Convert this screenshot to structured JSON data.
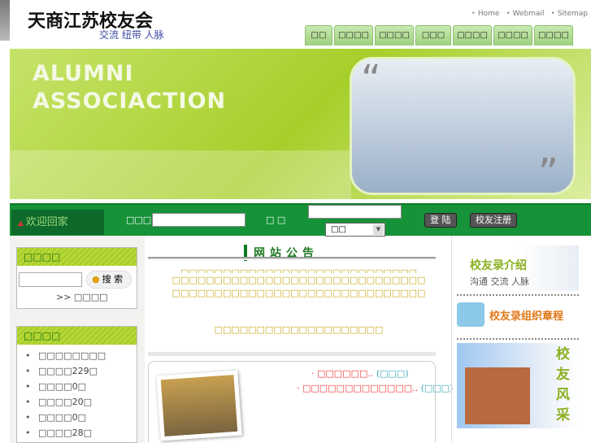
{
  "header": {
    "logo": "天商江苏校友会",
    "slogan": "交流  纽带  人脉",
    "links": [
      "Home",
      "Webmail",
      "Sitemap"
    ],
    "nav": [
      "□□",
      "□□□□",
      "□□□□",
      "□□□",
      "□□□□",
      "□□□□",
      "□□□□"
    ]
  },
  "banner": {
    "line1": "ALUMNI",
    "line2": "ASSOCIACTION"
  },
  "login": {
    "welcome": "欢迎回家",
    "user_label": "□□□",
    "pass_label": "□ □",
    "select_value": "□□",
    "login_button": "登 陆",
    "register_button": "校友注册"
  },
  "search": {
    "title": "□□□□",
    "button": "搜 索",
    "advanced": ">> □□□□"
  },
  "stats": {
    "title": "□□□□",
    "items": [
      "□□□□□□□□",
      "□□□□229□",
      "□□□□0□",
      "□□□□20□",
      "□□□□0□",
      "□□□□28□"
    ]
  },
  "notice": {
    "title": "网站公告",
    "lines": [
      "□□□□□□□□□□□□□□□□□□□□□□□□□□□□",
      "□□□□□□□□□□□□□□□□□□□□□□□□□□□□□□",
      "□□□□□□□□□□□□□□□□□□□□□□□□□□□□□□",
      "□□□□□□□□□□□□□□□□□□□□"
    ]
  },
  "news": [
    {
      "title": "□□□□□□..",
      "source": "(□□□)"
    },
    {
      "title": "□□□□□□□□□□□□□..",
      "source": "(□□□)"
    }
  ],
  "right": {
    "intro_title": "校友录介绍",
    "intro_sub": "沟通  交流  人脉",
    "charter": "校友录组织章程",
    "gallery": "校友风采"
  }
}
